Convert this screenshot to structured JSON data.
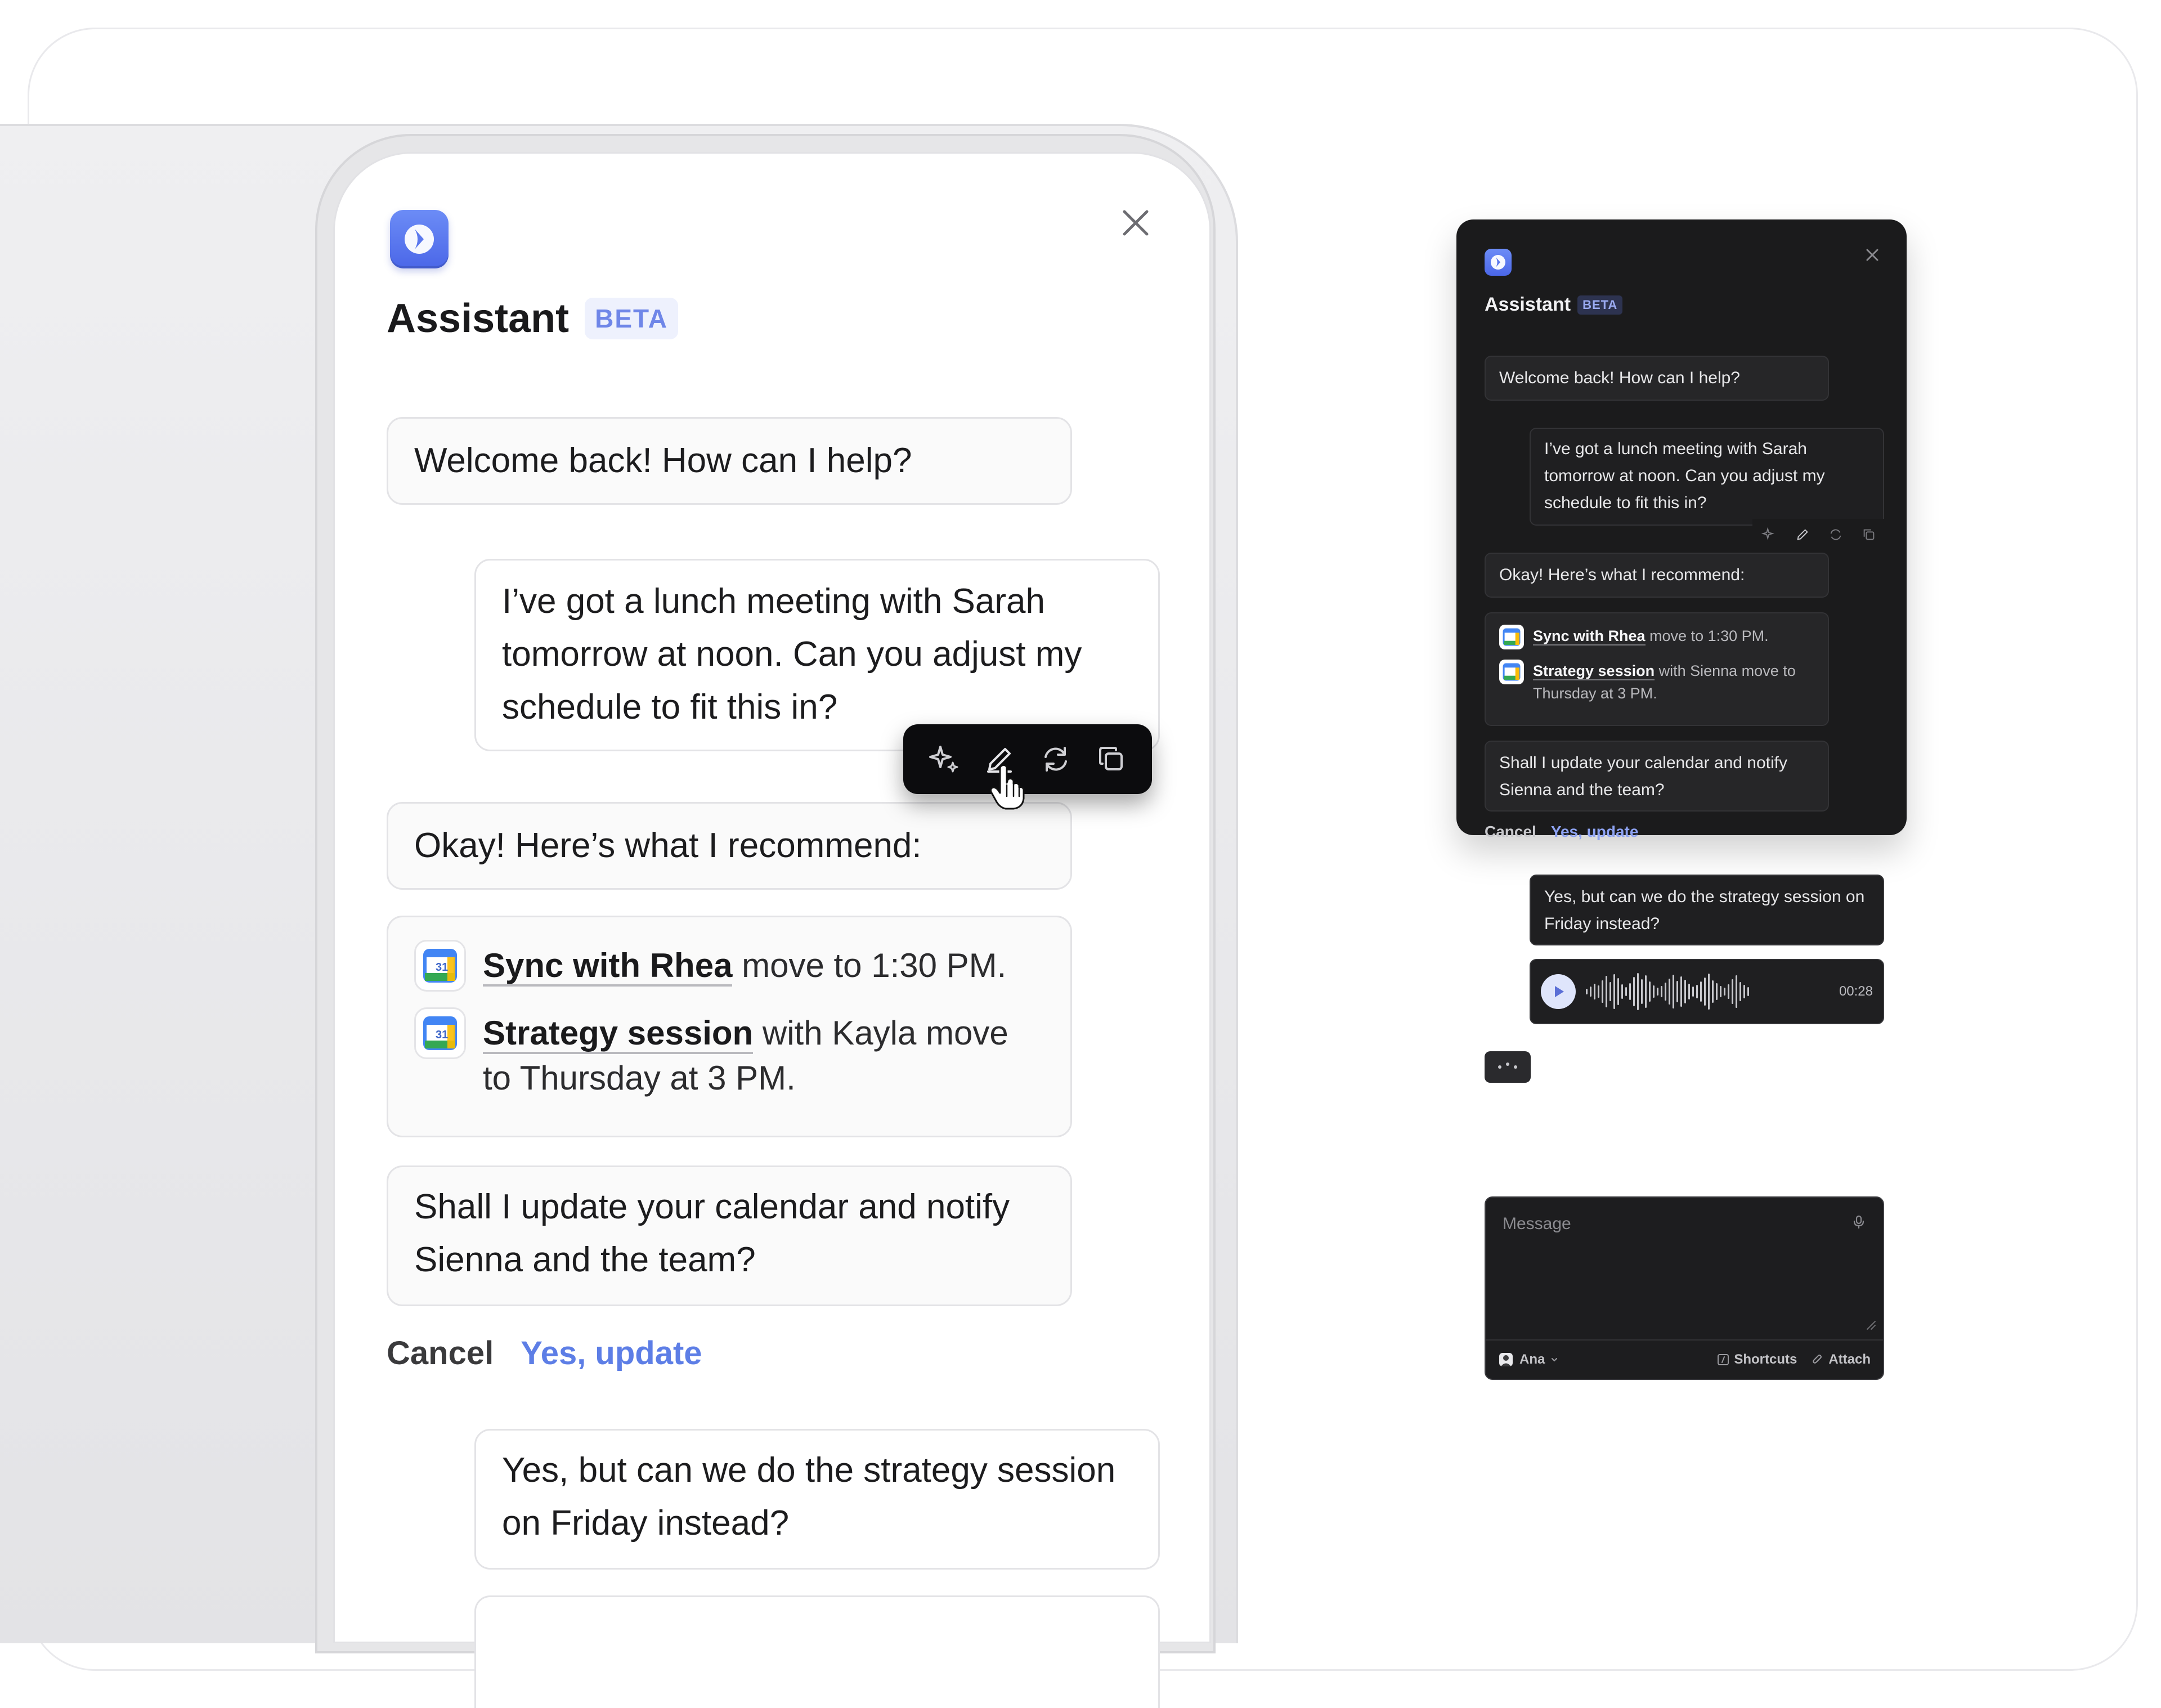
{
  "light_panel": {
    "title": "Assistant",
    "badge": "BETA",
    "messages": {
      "welcome": "Welcome back! How can I help?",
      "user_request": "I’ve got a lunch meeting with Sarah tomorrow at noon. Can you adjust my schedule to fit this in?",
      "recommend": "Okay! Here’s what I recommend:",
      "confirm": "Shall I update your calendar and notify Sienna and the team?",
      "followup": "Yes, but can we do the strategy session on Friday instead?"
    },
    "events": [
      {
        "name": "Sync with Rhea",
        "rest": " move to 1:30 PM."
      },
      {
        "name": "Strategy session",
        "rest": " with Kayla move to Thursday at 3 PM."
      }
    ],
    "actions": {
      "cancel": "Cancel",
      "confirm": "Yes, update"
    },
    "toolbar_icons": [
      "sparkle-icon",
      "pencil-icon",
      "refresh-icon",
      "copy-icon"
    ]
  },
  "dark_panel": {
    "title": "Assistant",
    "badge": "BETA",
    "messages": {
      "welcome": "Welcome back! How can I help?",
      "user_request": "I’ve got a lunch meeting with Sarah tomorrow at noon. Can you adjust my schedule to fit this in?",
      "recommend": "Okay! Here’s what I recommend:",
      "confirm": "Shall I update your calendar and notify Sienna and the team?",
      "followup": "Yes, but can we do the strategy session on Friday instead?"
    },
    "events": [
      {
        "name": "Sync with Rhea",
        "rest": " move to 1:30 PM."
      },
      {
        "name": "Strategy session",
        "rest": " with Sienna move to Thursday at 3 PM."
      }
    ],
    "actions": {
      "cancel": "Cancel",
      "confirm": "Yes, update"
    },
    "voice_duration": "00:28",
    "composer": {
      "placeholder": "Message",
      "user": "Ana",
      "shortcuts": "Shortcuts",
      "attach": "Attach"
    }
  },
  "colors": {
    "accent": "#5d7ee6",
    "logo": "#5b78ee",
    "dark_bg": "#1b1b1c",
    "light_bg": "#ffffff"
  }
}
